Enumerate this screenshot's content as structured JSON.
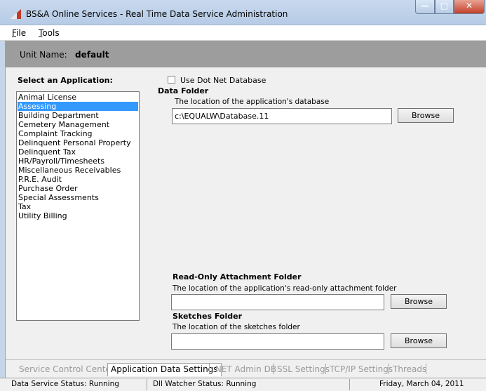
{
  "window": {
    "title": "BS&A Online Services - Real Time Data Service Administration",
    "controls": {
      "minimize": "—",
      "maximize": "□",
      "close": "✕"
    }
  },
  "menu": [
    {
      "label": "File",
      "underline": "F",
      "rest": "ile"
    },
    {
      "label": "Tools",
      "underline": "T",
      "rest": "ools"
    }
  ],
  "unit": {
    "label": "Unit Name:",
    "value": "default"
  },
  "applications": {
    "label": "Select an Application:",
    "items": [
      "Animal License",
      "Assessing",
      "Building Department",
      "Cemetery Management",
      "Complaint Tracking",
      "Delinquent Personal Property",
      "Delinquent Tax",
      "HR/Payroll/Timesheets",
      "Miscellaneous Receivables",
      "P.R.E. Audit",
      "Purchase Order",
      "Special Assessments",
      "Tax",
      "Utility Billing"
    ],
    "selected_index": 1
  },
  "settings": {
    "use_dot_net_label": "Use Dot Net Database",
    "use_dot_net_checked": false,
    "data_folder": {
      "title": "Data Folder",
      "description": "The location of the application's database",
      "value": "c:\\EQUALW\\Database.11",
      "browse_label": "Browse"
    },
    "readonly_folder": {
      "title": "Read-Only Attachment Folder",
      "description": "The location of the application's read-only attachment folder",
      "value": "",
      "browse_label": "Browse"
    },
    "sketches_folder": {
      "title": "Sketches Folder",
      "description": "The location of the sketches folder",
      "value": "",
      "browse_label": "Browse"
    }
  },
  "tabs": [
    {
      "label": "Service Control Center",
      "active": false
    },
    {
      "label": "Application Data Settings",
      "active": true
    },
    {
      "label": ".NET Admin DB",
      "active": false
    },
    {
      "label": "SSL Settings",
      "active": false
    },
    {
      "label": "TCP/IP Settings",
      "active": false
    },
    {
      "label": "Threads",
      "active": false
    }
  ],
  "status": {
    "data_service": "Data Service Status:  Running",
    "dll_watcher": "Dll Watcher Status: Running",
    "date": "Friday, March 04, 2011"
  },
  "colors": {
    "selection": "#3399ff",
    "unit_bar": "#9d9d9d",
    "close_button": "#c4402a"
  }
}
